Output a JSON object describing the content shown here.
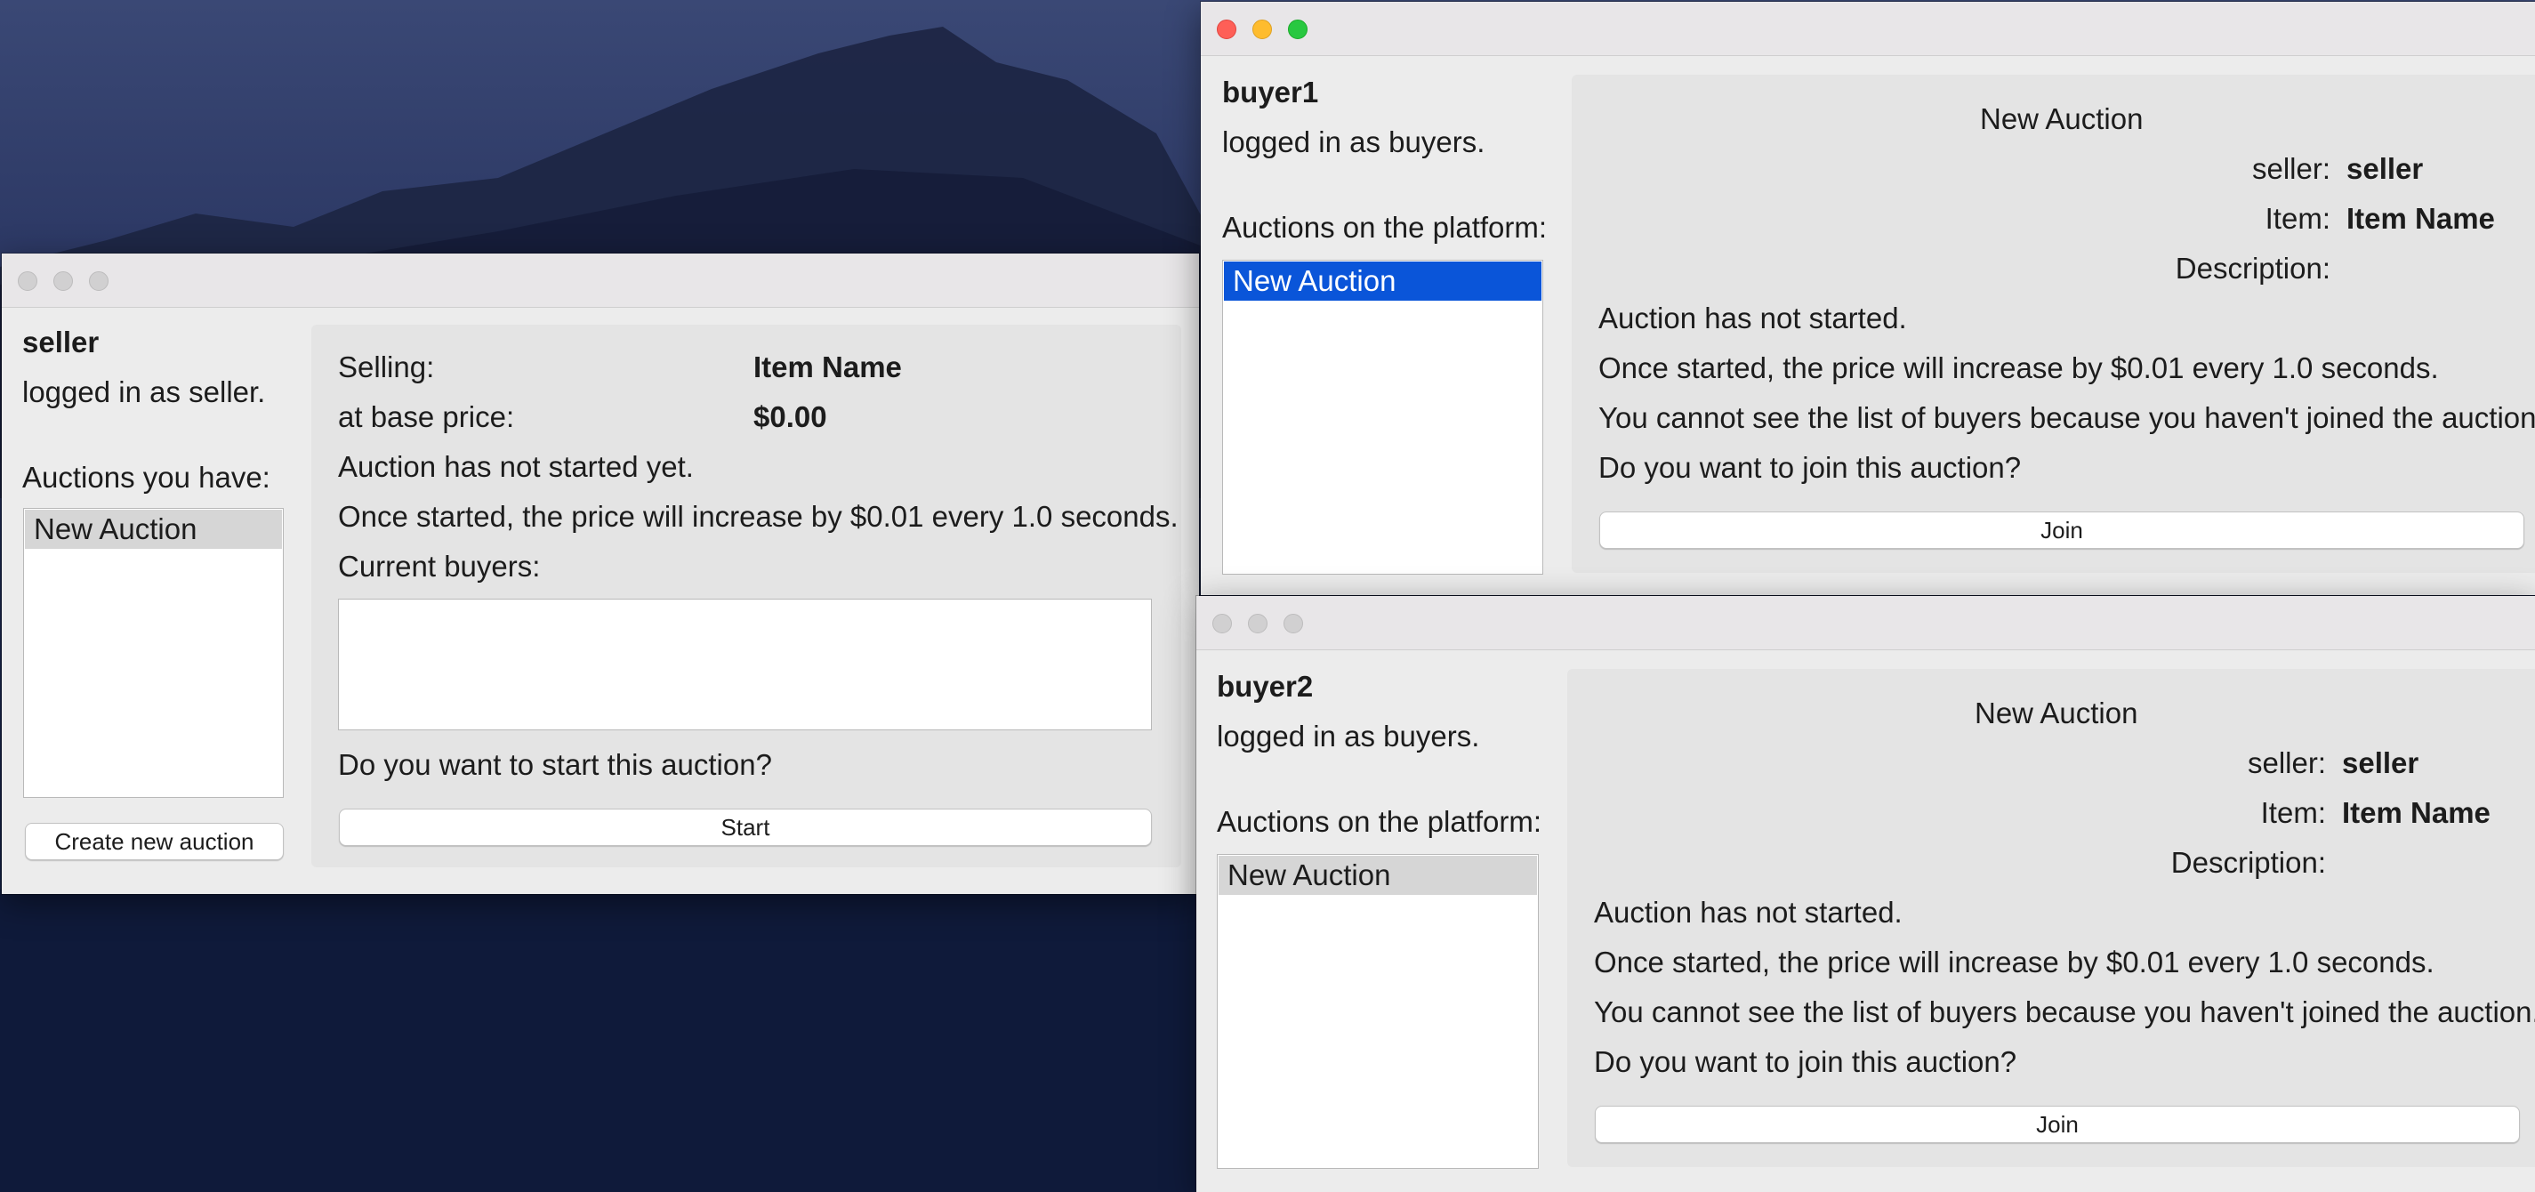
{
  "seller_window": {
    "username": "seller",
    "login_status": "logged in as seller.",
    "auctions_heading": "Auctions you have:",
    "auctions": [
      "New Auction"
    ],
    "create_button": "Create new auction",
    "selling_label": "Selling:",
    "item_name": "Item Name",
    "base_price_label": "at base price:",
    "base_price": "$0.00",
    "status": "Auction has not started yet.",
    "increase_note": "Once started, the price will increase by $0.01 every 1.0 seconds.",
    "current_buyers_label": "Current buyers:",
    "current_buyers_value": "",
    "start_question": "Do you want to start this auction?",
    "start_button": "Start"
  },
  "buyer1_window": {
    "username": "buyer1",
    "login_status": "logged in as buyers.",
    "auctions_heading": "Auctions on the platform:",
    "auctions": [
      "New Auction"
    ],
    "auction_title": "New Auction",
    "seller_label": "seller:",
    "seller_value": "seller",
    "item_label": "Item:",
    "item_value": "Item Name",
    "description_label": "Description:",
    "status": "Auction has not started.",
    "increase_note": "Once started, the price will increase by $0.01 every 1.0 seconds.",
    "buyers_note": "You cannot see the list of buyers because you haven't joined the auction.",
    "join_question": "Do you want to join this auction?",
    "join_button": "Join"
  },
  "buyer2_window": {
    "username": "buyer2",
    "login_status": "logged in as buyers.",
    "auctions_heading": "Auctions on the platform:",
    "auctions": [
      "New Auction"
    ],
    "auction_title": "New Auction",
    "seller_label": "seller:",
    "seller_value": "seller",
    "item_label": "Item:",
    "item_value": "Item Name",
    "description_label": "Description:",
    "status": "Auction has not started.",
    "increase_note": "Once started, the price will increase by $0.01 every 1.0 seconds.",
    "buyers_note": "You cannot see the list of buyers because you haven't joined the auction.",
    "join_question": "Do you want to join this auction?",
    "join_button": "Join"
  },
  "colors": {
    "selection_blue": "#0a55d9",
    "selection_gray": "#d6d6d6",
    "close_red": "#fe5f57",
    "minimize_yellow": "#febc2e",
    "zoom_green": "#28c840"
  }
}
